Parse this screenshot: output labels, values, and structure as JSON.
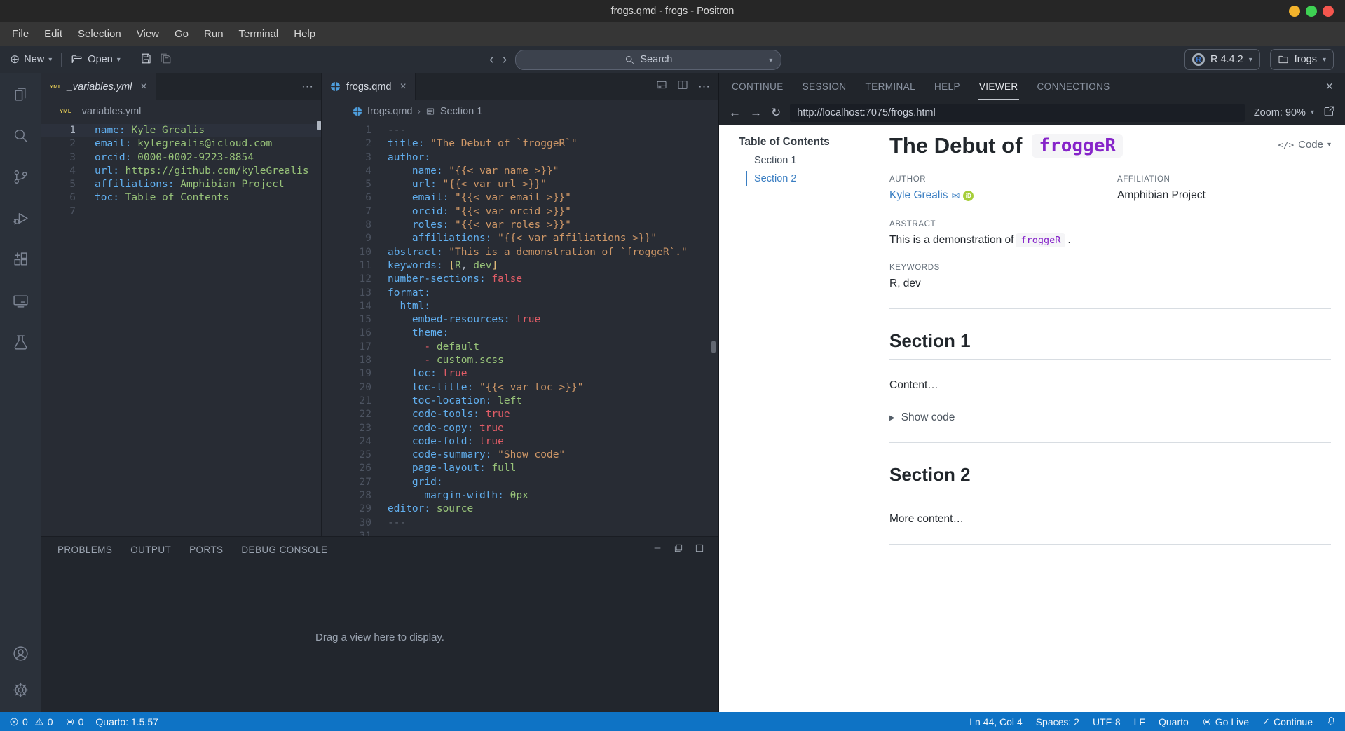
{
  "titlebar": {
    "title": "frogs.qmd - frogs - Positron"
  },
  "menubar": [
    "File",
    "Edit",
    "Selection",
    "View",
    "Go",
    "Run",
    "Terminal",
    "Help"
  ],
  "toolbar": {
    "new_label": "New",
    "open_label": "Open",
    "search_placeholder": "Search",
    "r_version": "R 4.4.2",
    "folder_name": "frogs"
  },
  "left_editor": {
    "tab_label": "_variables.yml",
    "breadcrumb_file": "_variables.yml",
    "active_line": 1,
    "lines": [
      [
        {
          "t": "name:",
          "c": "key"
        },
        {
          "t": " Kyle Grealis",
          "c": "val"
        }
      ],
      [
        {
          "t": "email:",
          "c": "key"
        },
        {
          "t": " kylegrealis@icloud.com",
          "c": "val"
        }
      ],
      [
        {
          "t": "orcid:",
          "c": "key"
        },
        {
          "t": " 0000-0002-9223-8854",
          "c": "val"
        }
      ],
      [
        {
          "t": "url:",
          "c": "key"
        },
        {
          "t": " ",
          "c": "plain"
        },
        {
          "t": "https://github.com/kyleGrealis",
          "c": "link"
        }
      ],
      [
        {
          "t": "affiliations:",
          "c": "key"
        },
        {
          "t": " Amphibian Project",
          "c": "val"
        }
      ],
      [
        {
          "t": "toc:",
          "c": "key"
        },
        {
          "t": " Table of Contents",
          "c": "val"
        }
      ],
      []
    ]
  },
  "right_editor": {
    "tab_label": "frogs.qmd",
    "breadcrumb_file": "frogs.qmd",
    "breadcrumb_section": "Section 1",
    "active_line": 0,
    "lines": [
      [
        {
          "t": "---",
          "c": "meta"
        }
      ],
      [
        {
          "t": "title:",
          "c": "key"
        },
        {
          "t": " \"The Debut of `froggeR`\"",
          "c": "str"
        }
      ],
      [
        {
          "t": "author:",
          "c": "key"
        }
      ],
      [
        {
          "t": "    name:",
          "c": "key"
        },
        {
          "t": " \"{{< var name >}}\"",
          "c": "str"
        }
      ],
      [
        {
          "t": "    url:",
          "c": "key"
        },
        {
          "t": " \"{{< var url >}}\"",
          "c": "str"
        }
      ],
      [
        {
          "t": "    email:",
          "c": "key"
        },
        {
          "t": " \"{{< var email >}}\"",
          "c": "str"
        }
      ],
      [
        {
          "t": "    orcid:",
          "c": "key"
        },
        {
          "t": " \"{{< var orcid >}}\"",
          "c": "str"
        }
      ],
      [
        {
          "t": "    roles:",
          "c": "key"
        },
        {
          "t": " \"{{< var roles >}}\"",
          "c": "str"
        }
      ],
      [
        {
          "t": "    affiliations:",
          "c": "key"
        },
        {
          "t": " \"{{< var affiliations >}}\"",
          "c": "str"
        }
      ],
      [
        {
          "t": "abstract:",
          "c": "key"
        },
        {
          "t": " \"This is a demonstration of `froggeR`.\"",
          "c": "str"
        }
      ],
      [
        {
          "t": "keywords:",
          "c": "key"
        },
        {
          "t": " ",
          "c": "plain"
        },
        {
          "t": "[",
          "c": "punct"
        },
        {
          "t": "R",
          "c": "val"
        },
        {
          "t": ", ",
          "c": "plain"
        },
        {
          "t": "dev",
          "c": "val"
        },
        {
          "t": "]",
          "c": "punct"
        }
      ],
      [
        {
          "t": "number-sections:",
          "c": "key"
        },
        {
          "t": " false",
          "c": "bool"
        }
      ],
      [
        {
          "t": "format:",
          "c": "key"
        }
      ],
      [
        {
          "t": "  html:",
          "c": "key"
        }
      ],
      [
        {
          "t": "    embed-resources:",
          "c": "key"
        },
        {
          "t": " true",
          "c": "bool"
        }
      ],
      [
        {
          "t": "    theme:",
          "c": "key"
        }
      ],
      [
        {
          "t": "      ",
          "c": "plain"
        },
        {
          "t": "- ",
          "c": "dash"
        },
        {
          "t": "default",
          "c": "val"
        }
      ],
      [
        {
          "t": "      ",
          "c": "plain"
        },
        {
          "t": "- ",
          "c": "dash"
        },
        {
          "t": "custom.scss",
          "c": "val"
        }
      ],
      [
        {
          "t": "    toc:",
          "c": "key"
        },
        {
          "t": " true",
          "c": "bool"
        }
      ],
      [
        {
          "t": "    toc-title:",
          "c": "key"
        },
        {
          "t": " \"{{< var toc >}}\"",
          "c": "str"
        }
      ],
      [
        {
          "t": "    toc-location:",
          "c": "key"
        },
        {
          "t": " left",
          "c": "val"
        }
      ],
      [
        {
          "t": "    code-tools:",
          "c": "key"
        },
        {
          "t": " true",
          "c": "bool"
        }
      ],
      [
        {
          "t": "    code-copy:",
          "c": "key"
        },
        {
          "t": " true",
          "c": "bool"
        }
      ],
      [
        {
          "t": "    code-fold:",
          "c": "key"
        },
        {
          "t": " true",
          "c": "bool"
        }
      ],
      [
        {
          "t": "    code-summary:",
          "c": "key"
        },
        {
          "t": " \"Show code\"",
          "c": "str"
        }
      ],
      [
        {
          "t": "    page-layout:",
          "c": "key"
        },
        {
          "t": " full",
          "c": "val"
        }
      ],
      [
        {
          "t": "    grid:",
          "c": "key"
        }
      ],
      [
        {
          "t": "      margin-width:",
          "c": "key"
        },
        {
          "t": " 0px",
          "c": "val"
        }
      ],
      [
        {
          "t": "editor:",
          "c": "key"
        },
        {
          "t": " source",
          "c": "val"
        }
      ],
      [
        {
          "t": "---",
          "c": "meta"
        }
      ],
      []
    ]
  },
  "bottom_panel": {
    "tabs": [
      "PROBLEMS",
      "OUTPUT",
      "PORTS",
      "DEBUG CONSOLE"
    ],
    "empty_message": "Drag a view here to display."
  },
  "right_panel": {
    "tabs": [
      "CONTINUE",
      "SESSION",
      "TERMINAL",
      "HELP",
      "VIEWER",
      "CONNECTIONS"
    ],
    "active_tab": "VIEWER",
    "url": "http://localhost:7075/frogs.html",
    "zoom_label": "Zoom: 90%"
  },
  "viewer": {
    "toc_title": "Table of Contents",
    "toc_items": [
      {
        "label": "Section 1",
        "active": false
      },
      {
        "label": "Section 2",
        "active": true
      }
    ],
    "title_text": "The Debut of",
    "title_code": "froggeR",
    "code_menu_label": "Code",
    "author_label": "AUTHOR",
    "author_name": "Kyle Grealis",
    "affiliation_label": "AFFILIATION",
    "affiliation": "Amphibian Project",
    "abstract_label": "ABSTRACT",
    "abstract_pre": "This is a demonstration of",
    "abstract_code": "froggeR",
    "abstract_post": ".",
    "keywords_label": "KEYWORDS",
    "keywords": "R, dev",
    "sections": [
      {
        "heading": "Section 1",
        "body": "Content…",
        "details": "Show code"
      },
      {
        "heading": "Section 2",
        "body": "More content…"
      }
    ]
  },
  "statusbar": {
    "errors": "0",
    "warnings": "0",
    "ports": "0",
    "quarto_version": "Quarto: 1.5.57",
    "line_col": "Ln 44, Col 4",
    "spaces": "Spaces: 2",
    "encoding": "UTF-8",
    "eol": "LF",
    "language": "Quarto",
    "go_live": "Go Live",
    "continue_label": "Continue"
  },
  "icons": {
    "plus_circle": "⊕",
    "chevron_down": "▾",
    "nav_back": "‹",
    "nav_forward": "›",
    "arrow_left": "←",
    "arrow_right": "→",
    "reload": "↻",
    "ellipsis": "⋯",
    "close": "×",
    "breadcrumb_sep": "›",
    "yml_badge": "YML",
    "code_glyph": "</>",
    "details_marker": "▶",
    "check": "✓",
    "envelope": "✉",
    "orcid": "iD"
  },
  "colors": {
    "status_bg": "#0e73c5",
    "link_blue": "#3a7ec2",
    "code_purple": "#8624c9",
    "editor_bg": "#282c34"
  }
}
